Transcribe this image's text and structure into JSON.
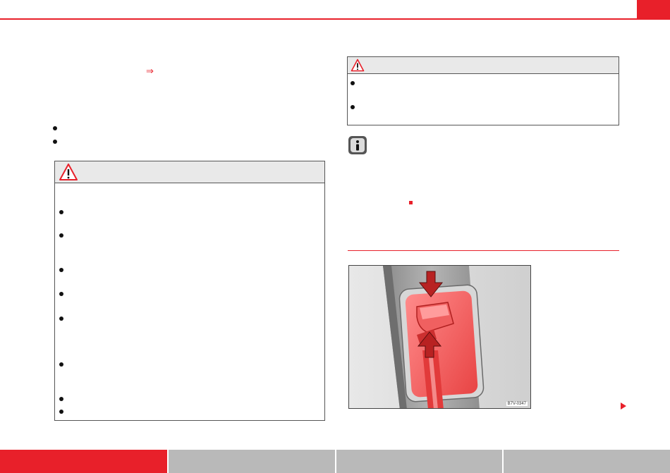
{
  "reference_arrow": "⇒",
  "figure": {
    "code": "B7V-0347"
  },
  "colors": {
    "accent": "#e8202a",
    "footer_active": "#e8202a",
    "footer_inactive": "#b9b9b9",
    "warning_header": "#e9e9e9"
  },
  "icons": {
    "left_warning": "warning-triangle-icon",
    "right_warning": "warning-triangle-icon",
    "note": "info-icon",
    "section_end": "red-square-end-marker",
    "continue": "continue-arrow-icon"
  },
  "footer": {
    "tabs": [
      "",
      "",
      "",
      ""
    ],
    "active_index": 0
  }
}
